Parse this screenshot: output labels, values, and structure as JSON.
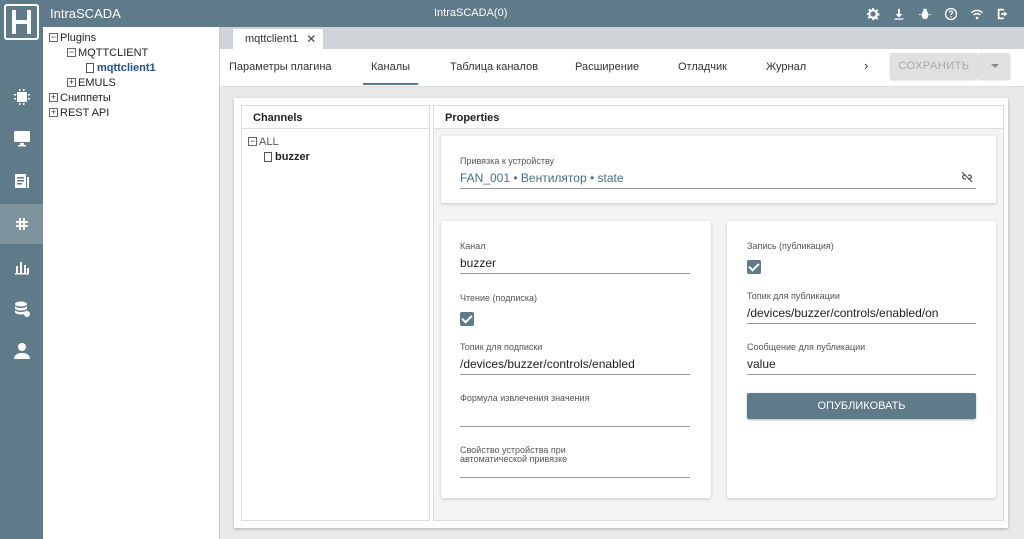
{
  "app": {
    "name": "IntraSCADA",
    "center_title": "IntraSCADA(0)"
  },
  "rail_icons": [
    "chip-icon",
    "monitor-icon",
    "document-icon",
    "plugins-icon",
    "chart-icon",
    "database-icon",
    "user-icon"
  ],
  "top_icons": [
    "gear-icon",
    "download-icon",
    "bug-icon",
    "help-icon",
    "wifi-icon",
    "logout-icon"
  ],
  "plugin_tree": {
    "plugins": "Plugins",
    "mqttclient": "MQTTCLIENT",
    "mqttclient1": "mqttclient1",
    "emuls": "EMULS",
    "snippets": "Сниппеты",
    "rest_api": "REST API",
    "expanded_mark": "−",
    "collapsed_mark": "+"
  },
  "doc_tab": {
    "label": "mqttclient1",
    "close": "✕"
  },
  "tabs": [
    {
      "label": "Параметры плагина"
    },
    {
      "label": "Каналы"
    },
    {
      "label": "Таблица каналов"
    },
    {
      "label": "Расширение"
    },
    {
      "label": "Отладчик"
    },
    {
      "label": "Журнал"
    }
  ],
  "tab_scroll": "›",
  "save_label": "СОХРАНИТЬ",
  "channels": {
    "title": "Channels",
    "all": "ALL",
    "item": "buzzer"
  },
  "properties": {
    "title": "Properties",
    "device_binding": {
      "label": "Привязка к устройству",
      "value": "FAN_001 • Вентилятор • state"
    },
    "channel": {
      "label": "Канал",
      "value": "buzzer"
    },
    "read": {
      "label": "Чтение (подписка)",
      "checked": true
    },
    "subscribe_topic": {
      "label": "Топик для подписки",
      "value": "/devices/buzzer/controls/enabled"
    },
    "formula": {
      "label": "Формула извлечения значения",
      "value": ""
    },
    "auto_prop": {
      "label_line1": "Свойство устройства при",
      "label_line2": "автоматической привязке",
      "value": ""
    },
    "write": {
      "label": "Запись (публикация)",
      "checked": true
    },
    "publish_topic": {
      "label": "Топик для публикации",
      "value": "/devices/buzzer/controls/enabled/on"
    },
    "publish_message": {
      "label": "Сообщение для публикации",
      "value": "value"
    },
    "publish_button": "ОПУБЛИКОВАТЬ"
  }
}
